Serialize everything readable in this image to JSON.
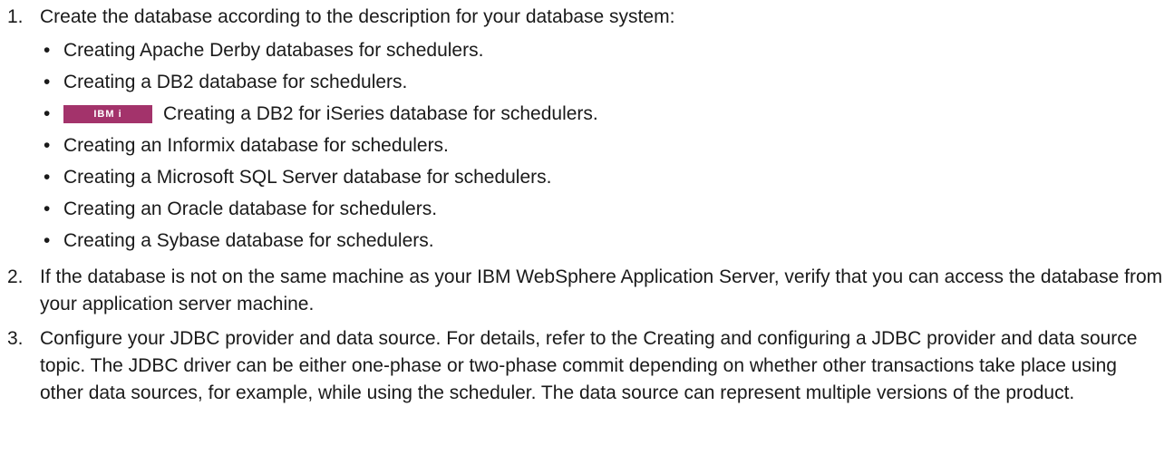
{
  "steps": [
    {
      "number": "1.",
      "text": "Create the database according to the description for your database system:",
      "items": [
        {
          "text": "Creating Apache Derby databases for schedulers."
        },
        {
          "text": "Creating a DB2 database for schedulers."
        },
        {
          "badge": "IBM i",
          "text": "Creating a DB2 for iSeries database for schedulers."
        },
        {
          "text": "Creating an Informix database for schedulers."
        },
        {
          "text": "Creating a Microsoft SQL Server database for schedulers."
        },
        {
          "text": "Creating an Oracle database for schedulers."
        },
        {
          "text": "Creating a Sybase database for schedulers."
        }
      ]
    },
    {
      "number": "2.",
      "text": "If the database is not on the same machine as your IBM WebSphere Application Server, verify that you can access the database from your application server machine."
    },
    {
      "number": "3.",
      "text": "Configure your JDBC provider and data source. For details, refer to the Creating and configuring a JDBC provider and data source topic. The JDBC driver can be either one-phase or two-phase commit depending on whether other transactions take place using other data sources, for example, while using the scheduler. The data source can represent multiple versions of the product."
    }
  ],
  "bullet_char": "•",
  "badge_color": "#a3336b"
}
